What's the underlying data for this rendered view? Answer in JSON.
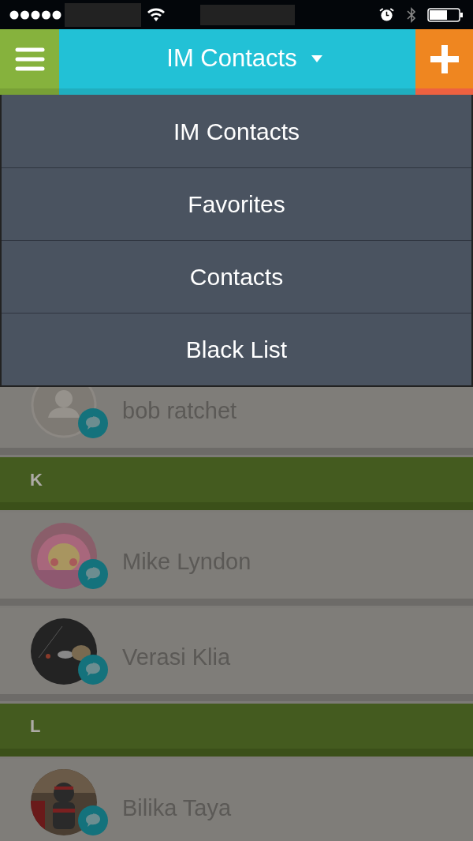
{
  "header": {
    "title": "IM Contacts"
  },
  "dropdown": {
    "items": [
      {
        "label": "IM Contacts"
      },
      {
        "label": "Favorites"
      },
      {
        "label": "Contacts"
      },
      {
        "label": "Black List"
      }
    ]
  },
  "list": [
    {
      "kind": "contact",
      "name": "bob ratchet",
      "avatar": {
        "kind": "placeholder"
      }
    },
    {
      "kind": "section",
      "letter": "K"
    },
    {
      "kind": "contact",
      "name": "Mike Lyndon"
    },
    {
      "kind": "contact",
      "name": "Verasi Klia"
    },
    {
      "kind": "section",
      "letter": "L"
    },
    {
      "kind": "contact",
      "name": "Bilika Taya"
    }
  ]
}
